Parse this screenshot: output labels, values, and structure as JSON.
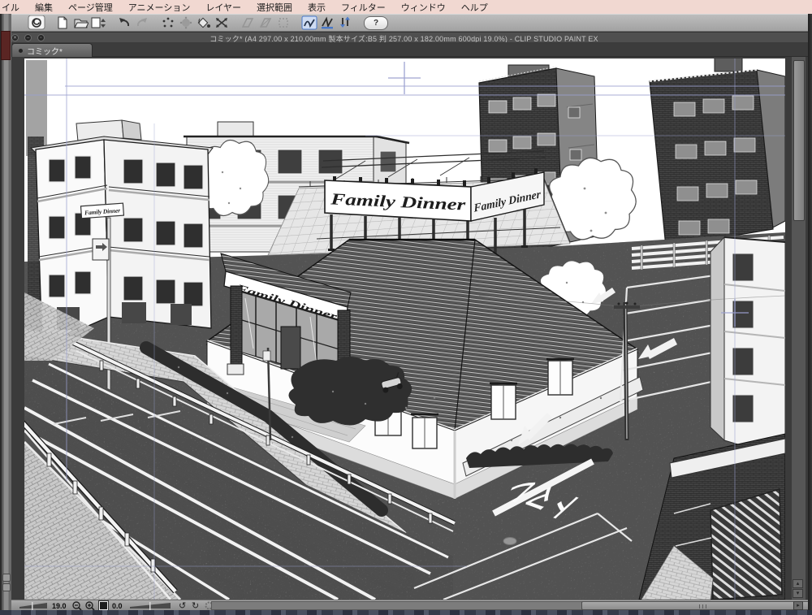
{
  "menu_bar": {
    "items": [
      "イル",
      "編集",
      "ページ管理",
      "アニメーション",
      "レイヤー",
      "選択範囲",
      "表示",
      "フィルター",
      "ウィンドウ",
      "ヘルプ"
    ]
  },
  "toolbar": {
    "help_label": "?"
  },
  "window": {
    "title": "コミック* (A4 297.00 x 210.00mm 製本サイズ:B5 判 257.00 x 182.00mm 600dpi 19.0%)  - CLIP STUDIO PAINT EX",
    "controls": {
      "close": "✕",
      "minimize": "–",
      "maximize": "▫"
    }
  },
  "tab_bar": {
    "active_tab": "コミック*"
  },
  "artwork": {
    "billboard_front": "Family Dinner",
    "billboard_side": "Family Dinner",
    "entrance_sign": "Family Dinner",
    "pole_sign": "Family Dinner",
    "road_marking": "トマレ"
  },
  "status_bar": {
    "zoom_value": "19.0",
    "rotation_value": "0.0"
  },
  "colors": {
    "menu_bg": "#f1d8d1",
    "canvas_bg": "#3b3b3b",
    "guide": "#9aa0cf",
    "snap_accent": "#4a78c8"
  }
}
